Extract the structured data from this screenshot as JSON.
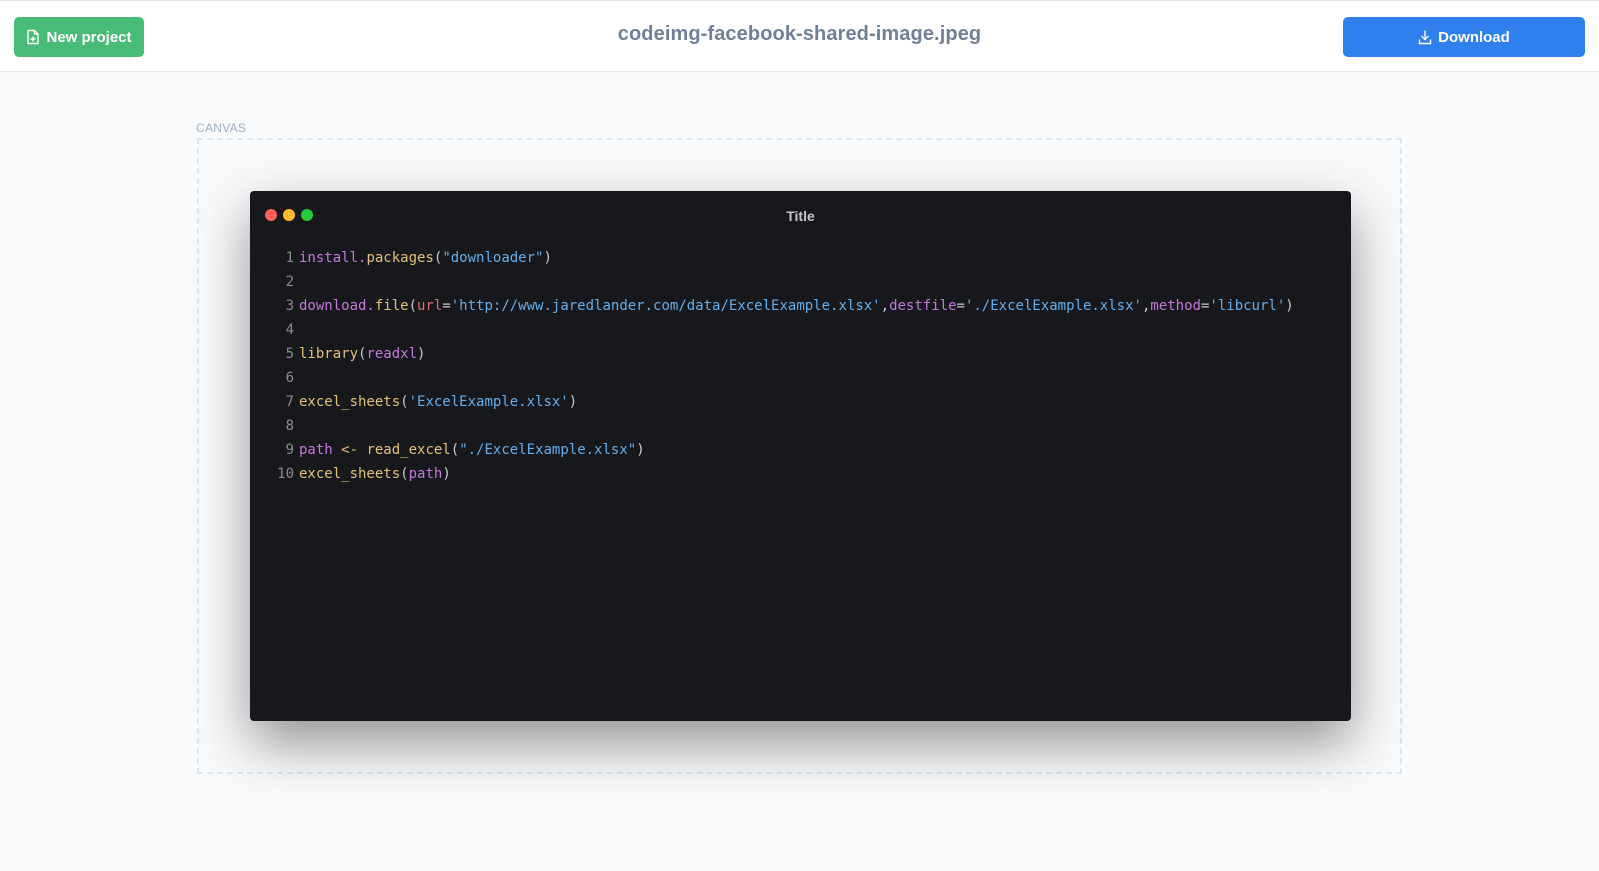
{
  "topbar": {
    "new_project_label": "New project",
    "file_title": "codeimg-facebook-shared-image.jpeg",
    "download_label": "Download"
  },
  "canvas": {
    "label": "CANVAS"
  },
  "window": {
    "title": "Title",
    "dots": [
      "#ff5f56",
      "#ffbd2e",
      "#27c93f"
    ]
  },
  "code": {
    "lines": [
      {
        "n": "1",
        "tokens": [
          {
            "t": "install.",
            "c": "t-kw"
          },
          {
            "t": "packages",
            "c": "t-fn"
          },
          {
            "t": "(",
            "c": "t-plain"
          },
          {
            "t": "\"downloader\"",
            "c": "t-str"
          },
          {
            "t": ")",
            "c": "t-plain"
          }
        ]
      },
      {
        "n": "2",
        "tokens": []
      },
      {
        "n": "3",
        "tokens": [
          {
            "t": "download.",
            "c": "t-kw"
          },
          {
            "t": "file",
            "c": "t-fn"
          },
          {
            "t": "(",
            "c": "t-plain"
          },
          {
            "t": "url",
            "c": "t-param"
          },
          {
            "t": "=",
            "c": "t-plain"
          },
          {
            "t": "'http://www.jaredlander.com/data/ExcelExample.xlsx'",
            "c": "t-str"
          },
          {
            "t": ",",
            "c": "t-plain"
          },
          {
            "t": "destfile",
            "c": "t-kw"
          },
          {
            "t": "=",
            "c": "t-plain"
          },
          {
            "t": "'./ExcelExample.xlsx'",
            "c": "t-str"
          },
          {
            "t": ",",
            "c": "t-plain"
          },
          {
            "t": "method",
            "c": "t-kw"
          },
          {
            "t": "=",
            "c": "t-plain"
          },
          {
            "t": "'libcurl'",
            "c": "t-str"
          },
          {
            "t": ")",
            "c": "t-plain"
          }
        ]
      },
      {
        "n": "4",
        "tokens": []
      },
      {
        "n": "5",
        "tokens": [
          {
            "t": "library",
            "c": "t-fn"
          },
          {
            "t": "(",
            "c": "t-plain"
          },
          {
            "t": "readxl",
            "c": "t-kw"
          },
          {
            "t": ")",
            "c": "t-plain"
          }
        ]
      },
      {
        "n": "6",
        "tokens": []
      },
      {
        "n": "7",
        "tokens": [
          {
            "t": "excel_sheets",
            "c": "t-fn"
          },
          {
            "t": "(",
            "c": "t-plain"
          },
          {
            "t": "'ExcelExample.xlsx'",
            "c": "t-str"
          },
          {
            "t": ")",
            "c": "t-plain"
          }
        ]
      },
      {
        "n": "8",
        "tokens": []
      },
      {
        "n": "9",
        "tokens": [
          {
            "t": "path",
            "c": "t-kw"
          },
          {
            "t": " ",
            "c": "t-plain"
          },
          {
            "t": "<-",
            "c": "t-op"
          },
          {
            "t": " ",
            "c": "t-plain"
          },
          {
            "t": "read_excel",
            "c": "t-fn"
          },
          {
            "t": "(",
            "c": "t-plain"
          },
          {
            "t": "\"./ExcelExample.xlsx\"",
            "c": "t-str"
          },
          {
            "t": ")",
            "c": "t-plain"
          }
        ]
      },
      {
        "n": "10",
        "tokens": [
          {
            "t": "excel_sheets",
            "c": "t-fn"
          },
          {
            "t": "(",
            "c": "t-plain"
          },
          {
            "t": "path",
            "c": "t-kw"
          },
          {
            "t": ")",
            "c": "t-plain"
          }
        ]
      }
    ]
  }
}
